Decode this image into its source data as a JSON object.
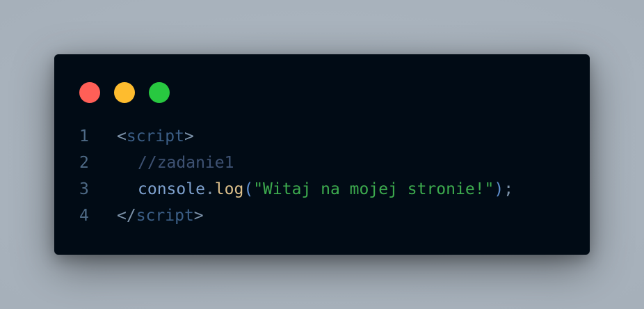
{
  "window": {
    "controls": [
      {
        "name": "close",
        "color": "#ff5f57"
      },
      {
        "name": "minimize",
        "color": "#febc2e"
      },
      {
        "name": "maximize",
        "color": "#28c840"
      }
    ]
  },
  "code": {
    "lines": [
      {
        "number": "1",
        "open": "<",
        "tag": "script",
        "close": ">"
      },
      {
        "number": "2",
        "comment": "//zadanie1"
      },
      {
        "number": "3",
        "object": "console",
        "dot": ".",
        "method": "log",
        "paren_open": "(",
        "string": "\"Witaj na mojej stronie!\"",
        "paren_close": ")",
        "semicolon": ";"
      },
      {
        "number": "4",
        "open": "</",
        "tag": "script",
        "close": ">"
      }
    ]
  }
}
